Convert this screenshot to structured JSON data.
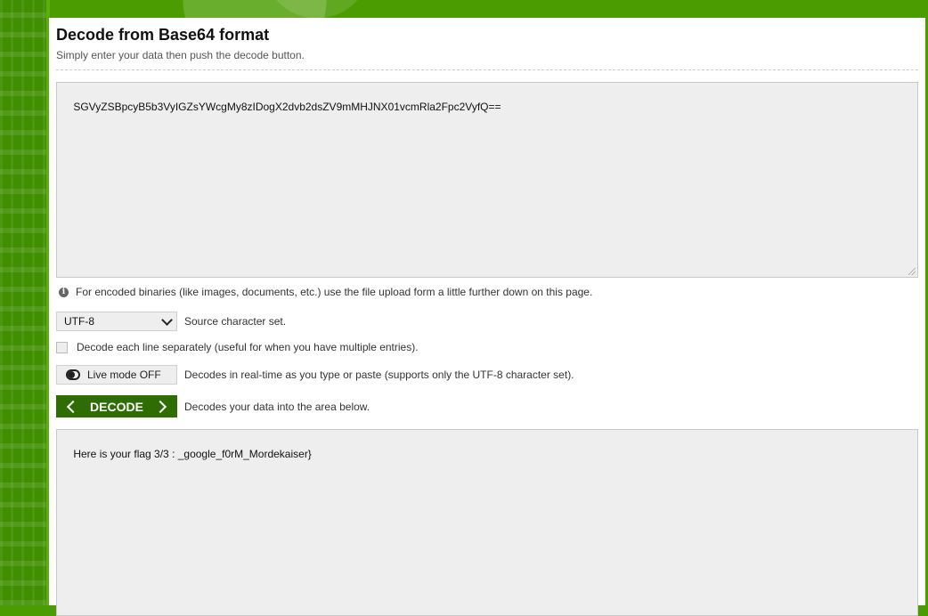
{
  "page": {
    "title": "Decode from Base64 format",
    "subtitle": "Simply enter your data then push the decode button."
  },
  "input": {
    "value": "SGVyZSBpcyB5b3VyIGZsYWcgMy8zIDogX2dvb2dsZV9mMHJNX01vcmRla2Fpc2VyfQ=="
  },
  "info": {
    "icon": "info-icon",
    "text": "For encoded binaries (like images, documents, etc.) use the file upload form a little further down on this page."
  },
  "charset": {
    "selected": "UTF-8",
    "label": "Source character set."
  },
  "decode_each_line": {
    "checked": false,
    "label": "Decode each line separately (useful for when you have multiple entries)."
  },
  "live_mode": {
    "button_label": "Live mode OFF",
    "description": "Decodes in real-time as you type or paste (supports only the UTF-8 character set)."
  },
  "decode": {
    "button_label": "DECODE",
    "description": "Decodes your data into the area below."
  },
  "output": {
    "value": "Here is your flag 3/3 : _google_f0rM_Mordekaiser}"
  },
  "colors": {
    "brand_green": "#4a9c00",
    "decode_button": "#2f6d04",
    "field_background": "#eeeeee"
  }
}
